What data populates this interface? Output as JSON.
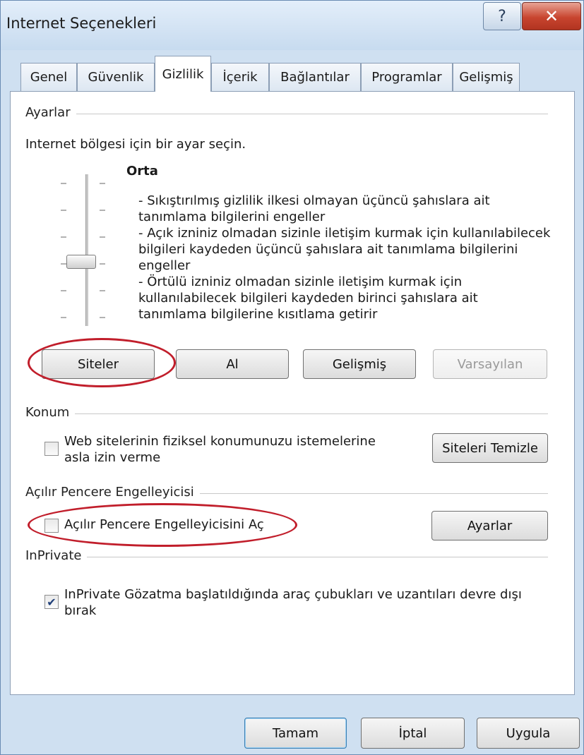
{
  "window": {
    "title": "Internet Seçenekleri",
    "help_icon": "question-mark-icon",
    "close_icon": "close-x-icon"
  },
  "tabs": [
    {
      "label": "Genel",
      "active": false
    },
    {
      "label": "Güvenlik",
      "active": false
    },
    {
      "label": "Gizlilik",
      "active": true
    },
    {
      "label": "İçerik",
      "active": false
    },
    {
      "label": "Bağlantılar",
      "active": false
    },
    {
      "label": "Programlar",
      "active": false
    },
    {
      "label": "Gelişmiş",
      "active": false
    }
  ],
  "settings": {
    "group_label": "Ayarlar",
    "instruction": "Internet bölgesi için bir ayar seçin.",
    "level_title": "Orta",
    "slider_level": "Orta",
    "description_lines": [
      "- Sıkıştırılmış gizlilik ilkesi olmayan üçüncü şahıslara ait",
      "tanımlama bilgilerini engeller",
      "- Açık izniniz olmadan sizinle iletişim kurmak için kullanılabilecek",
      "bilgileri kaydeden üçüncü şahıslara ait tanımlama bilgilerini",
      "engeller",
      "- Örtülü izniniz olmadan sizinle iletişim kurmak için",
      "kullanılabilecek bilgileri kaydeden birinci şahıslara ait",
      "tanımlama bilgilerine kısıtlama getirir"
    ],
    "buttons": {
      "sites": "Siteler",
      "import": "Al",
      "advanced": "Gelişmiş",
      "default": "Varsayılan"
    }
  },
  "location": {
    "group_label": "Konum",
    "checkbox_label_line1": "Web sitelerinin fiziksel konumunuzu istemelerine",
    "checkbox_label_line2": "asla izin verme",
    "checked": false,
    "clear_sites_button": "Siteleri Temizle"
  },
  "popup": {
    "group_label": "Açılır Pencere Engelleyicisi",
    "checkbox_label": "Açılır Pencere Engelleyicisini Aç",
    "checked": false,
    "settings_button": "Ayarlar"
  },
  "inprivate": {
    "group_label": "InPrivate",
    "checkbox_label_line1": "InPrivate Gözatma başlatıldığında araç çubukları ve uzantıları devre dışı",
    "checkbox_label_line2": "bırak",
    "checked": true
  },
  "footer": {
    "ok": "Tamam",
    "cancel": "İptal",
    "apply": "Uygula"
  },
  "annotation_color": "#c11e2b"
}
